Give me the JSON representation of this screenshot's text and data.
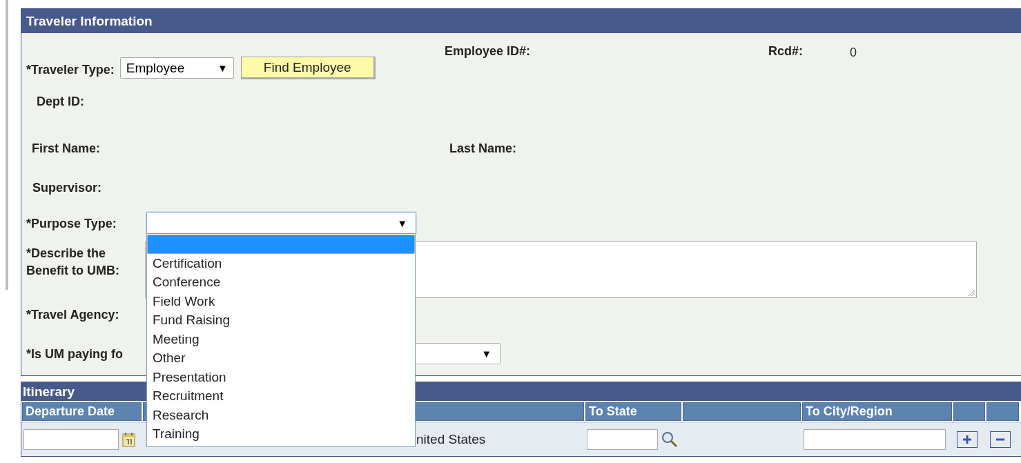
{
  "traveler_information": {
    "title": "Traveler Information",
    "traveler_type": {
      "label": "*Traveler Type:",
      "value": "Employee",
      "arrow": "▼"
    },
    "find_button": "Find Employee",
    "employee_id": {
      "label": "Employee ID#:"
    },
    "rcd": {
      "label": "Rcd#:",
      "value": "0"
    },
    "dept_id": {
      "label": "Dept ID:"
    },
    "first_name": {
      "label": "First Name:"
    },
    "last_name": {
      "label": "Last Name:"
    },
    "supervisor": {
      "label": "Supervisor:"
    },
    "purpose_type": {
      "label": "*Purpose Type:",
      "arrow": "▼",
      "expanded": true,
      "options": [
        {
          "selected": true
        },
        {
          "label": "Certification",
          "selected": false
        },
        {
          "label": "Conference",
          "selected": false
        },
        {
          "label": "Field Work",
          "selected": false
        },
        {
          "label": "Fund Raising",
          "selected": false
        },
        {
          "label": "Meeting",
          "selected": false
        },
        {
          "label": "Other",
          "selected": false
        },
        {
          "label": "Presentation",
          "selected": false
        },
        {
          "label": "Recruitment",
          "selected": false
        },
        {
          "label": "Research",
          "selected": false
        },
        {
          "label": "Training",
          "selected": false
        }
      ]
    },
    "benefit": {
      "label": "*Describe the Benefit to UMB:"
    },
    "travel_agency": {
      "label": "*Travel Agency:"
    },
    "um_paying": {
      "label": "*Is UM paying fo",
      "arrow": "▼"
    }
  },
  "itinerary": {
    "title": "Itinerary",
    "columns": [
      {
        "label": "Departure Date"
      },
      {
        "label": "To State"
      },
      {
        "label": "To City/Region"
      }
    ],
    "row": {
      "country": "nited States"
    }
  }
}
